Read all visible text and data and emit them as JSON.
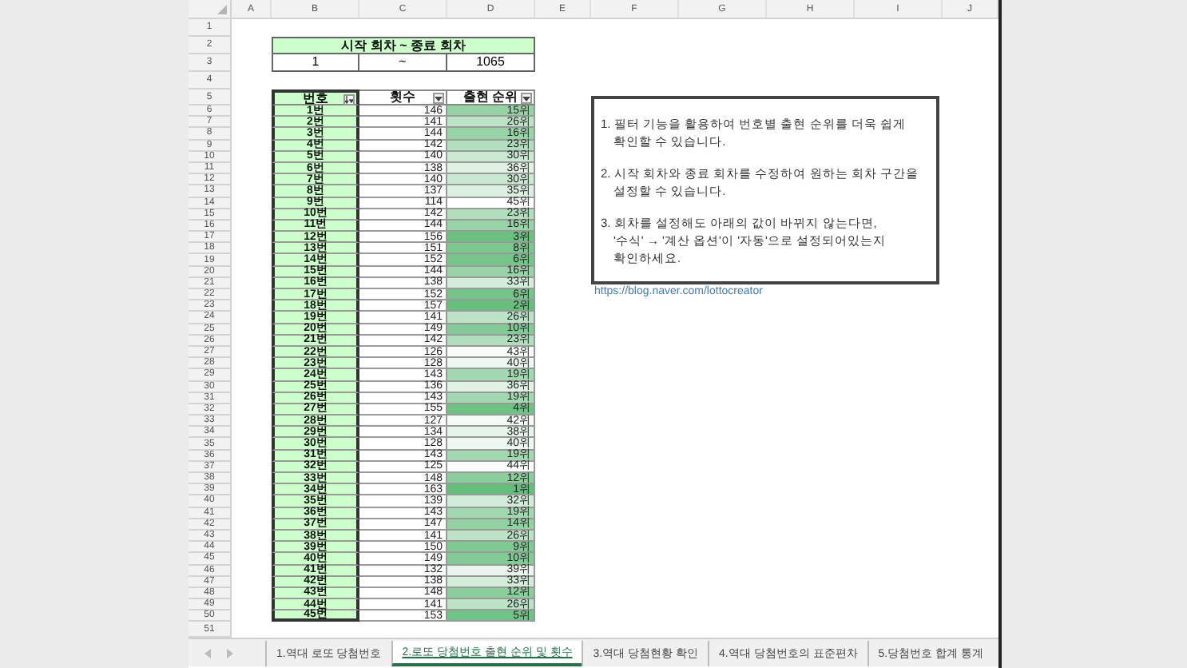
{
  "columns": [
    "A",
    "B",
    "C",
    "D",
    "E",
    "F",
    "G",
    "H",
    "I",
    "J"
  ],
  "row_numbers": [
    "1",
    "2",
    "3",
    "4",
    "5",
    "6",
    "7",
    "8",
    "9",
    "10",
    "11",
    "12",
    "13",
    "14",
    "15",
    "16",
    "17",
    "18",
    "19",
    "20",
    "21",
    "22",
    "23",
    "24",
    "25",
    "26",
    "27",
    "28",
    "29",
    "30",
    "31",
    "32",
    "33",
    "34",
    "35",
    "36",
    "37",
    "38",
    "39",
    "40",
    "41",
    "42",
    "43",
    "44",
    "45",
    "46",
    "47",
    "48",
    "49",
    "50",
    "51"
  ],
  "range_box": {
    "title": "시작 회차 ~ 종료 회차",
    "start": "1",
    "separator": "~",
    "end": "1065"
  },
  "table": {
    "columns": [
      {
        "label": "번호",
        "kind": "sorted"
      },
      {
        "label": "횟수",
        "kind": "filter"
      },
      {
        "label": "출현 순위",
        "kind": "filter"
      }
    ],
    "rows": [
      {
        "number": "1번",
        "count": "146",
        "rank": "15위",
        "color": "#95d3a5"
      },
      {
        "number": "2번",
        "count": "141",
        "rank": "26위",
        "color": "#bce3c6"
      },
      {
        "number": "3번",
        "count": "144",
        "rank": "16위",
        "color": "#98d4a8"
      },
      {
        "number": "4번",
        "count": "142",
        "rank": "23위",
        "color": "#b1debd"
      },
      {
        "number": "5번",
        "count": "140",
        "rank": "30위",
        "color": "#cae9d2"
      },
      {
        "number": "6번",
        "count": "138",
        "rank": "36위",
        "color": "#dff2e4"
      },
      {
        "number": "7번",
        "count": "140",
        "rank": "30위",
        "color": "#cae9d2"
      },
      {
        "number": "8번",
        "count": "137",
        "rank": "35위",
        "color": "#dcf0e1"
      },
      {
        "number": "9번",
        "count": "114",
        "rank": "45위",
        "color": "#ffffff"
      },
      {
        "number": "10번",
        "count": "142",
        "rank": "23위",
        "color": "#b1debd"
      },
      {
        "number": "11번",
        "count": "144",
        "rank": "16위",
        "color": "#98d4a8"
      },
      {
        "number": "12번",
        "count": "156",
        "rank": "3위",
        "color": "#6ac181"
      },
      {
        "number": "13번",
        "count": "151",
        "rank": "8위",
        "color": "#7cc890"
      },
      {
        "number": "14번",
        "count": "152",
        "rank": "6위",
        "color": "#75c58a"
      },
      {
        "number": "15번",
        "count": "144",
        "rank": "16위",
        "color": "#98d4a8"
      },
      {
        "number": "16번",
        "count": "138",
        "rank": "33위",
        "color": "#d4eddb"
      },
      {
        "number": "17번",
        "count": "152",
        "rank": "6위",
        "color": "#75c58a"
      },
      {
        "number": "18번",
        "count": "157",
        "rank": "2위",
        "color": "#67bf7e"
      },
      {
        "number": "19번",
        "count": "141",
        "rank": "26위",
        "color": "#bce3c6"
      },
      {
        "number": "20번",
        "count": "149",
        "rank": "10위",
        "color": "#83cb96"
      },
      {
        "number": "21번",
        "count": "142",
        "rank": "23위",
        "color": "#b1debd"
      },
      {
        "number": "22번",
        "count": "126",
        "rank": "43위",
        "color": "#f8fcf9"
      },
      {
        "number": "23번",
        "count": "128",
        "rank": "40위",
        "color": "#edf8f0"
      },
      {
        "number": "24번",
        "count": "143",
        "rank": "19위",
        "color": "#a3d9b1"
      },
      {
        "number": "25번",
        "count": "136",
        "rank": "36위",
        "color": "#dff2e4"
      },
      {
        "number": "26번",
        "count": "143",
        "rank": "19위",
        "color": "#a3d9b1"
      },
      {
        "number": "27번",
        "count": "155",
        "rank": "4위",
        "color": "#6ec284"
      },
      {
        "number": "28번",
        "count": "127",
        "rank": "42위",
        "color": "#f4fbf6"
      },
      {
        "number": "29번",
        "count": "134",
        "rank": "38위",
        "color": "#e6f5ea"
      },
      {
        "number": "30번",
        "count": "128",
        "rank": "40위",
        "color": "#edf8f0"
      },
      {
        "number": "31번",
        "count": "143",
        "rank": "19위",
        "color": "#a3d9b1"
      },
      {
        "number": "32번",
        "count": "125",
        "rank": "44위",
        "color": "#fbfdfc"
      },
      {
        "number": "33번",
        "count": "148",
        "rank": "12위",
        "color": "#8ace9c"
      },
      {
        "number": "34번",
        "count": "163",
        "rank": "1위",
        "color": "#63be7b"
      },
      {
        "number": "35번",
        "count": "139",
        "rank": "32위",
        "color": "#d1ecd8"
      },
      {
        "number": "36번",
        "count": "143",
        "rank": "19위",
        "color": "#a3d9b1"
      },
      {
        "number": "37번",
        "count": "147",
        "rank": "14위",
        "color": "#91d1a2"
      },
      {
        "number": "38번",
        "count": "141",
        "rank": "26위",
        "color": "#bce3c6"
      },
      {
        "number": "39번",
        "count": "150",
        "rank": "9위",
        "color": "#7fca93"
      },
      {
        "number": "40번",
        "count": "149",
        "rank": "10위",
        "color": "#83cb96"
      },
      {
        "number": "41번",
        "count": "132",
        "rank": "39위",
        "color": "#eaf6ed"
      },
      {
        "number": "42번",
        "count": "138",
        "rank": "33위",
        "color": "#d4eddb"
      },
      {
        "number": "43번",
        "count": "148",
        "rank": "12위",
        "color": "#8ace9c"
      },
      {
        "number": "44번",
        "count": "141",
        "rank": "26위",
        "color": "#bce3c6"
      },
      {
        "number": "45번",
        "count": "153",
        "rank": "5위",
        "color": "#71c487"
      }
    ]
  },
  "note": {
    "paragraphs": [
      {
        "lines": [
          "1. 필터 기능을 활용하여 번호별 출현 순위를 더욱 쉽게",
          "확인할 수 있습니다."
        ]
      },
      {
        "lines": [
          "2. 시작 회차와 종료 회차를 수정하여 원하는 회차 구간을",
          "설정할 수 있습니다."
        ]
      },
      {
        "lines": [
          "3. 회차를 설정해도 아래의 값이 바뀌지 않는다면,",
          "'수식' → '계산 옵션'이 '자동'으로 설정되어있는지",
          "확인하세요."
        ]
      }
    ]
  },
  "link": "https://blog.naver.com/lottocreator",
  "sheet_tabs": [
    {
      "label": "1.역대 로또 당첨번호",
      "selected": false
    },
    {
      "label": "2.로또 당첨번호 출현 순위 및 횟수",
      "selected": true
    },
    {
      "label": "3.역대 당첨현황 확인",
      "selected": false
    },
    {
      "label": "4.역대 당첨번호의 표준편차",
      "selected": false
    },
    {
      "label": "5.당첨번호 합계 통계",
      "selected": false
    }
  ]
}
